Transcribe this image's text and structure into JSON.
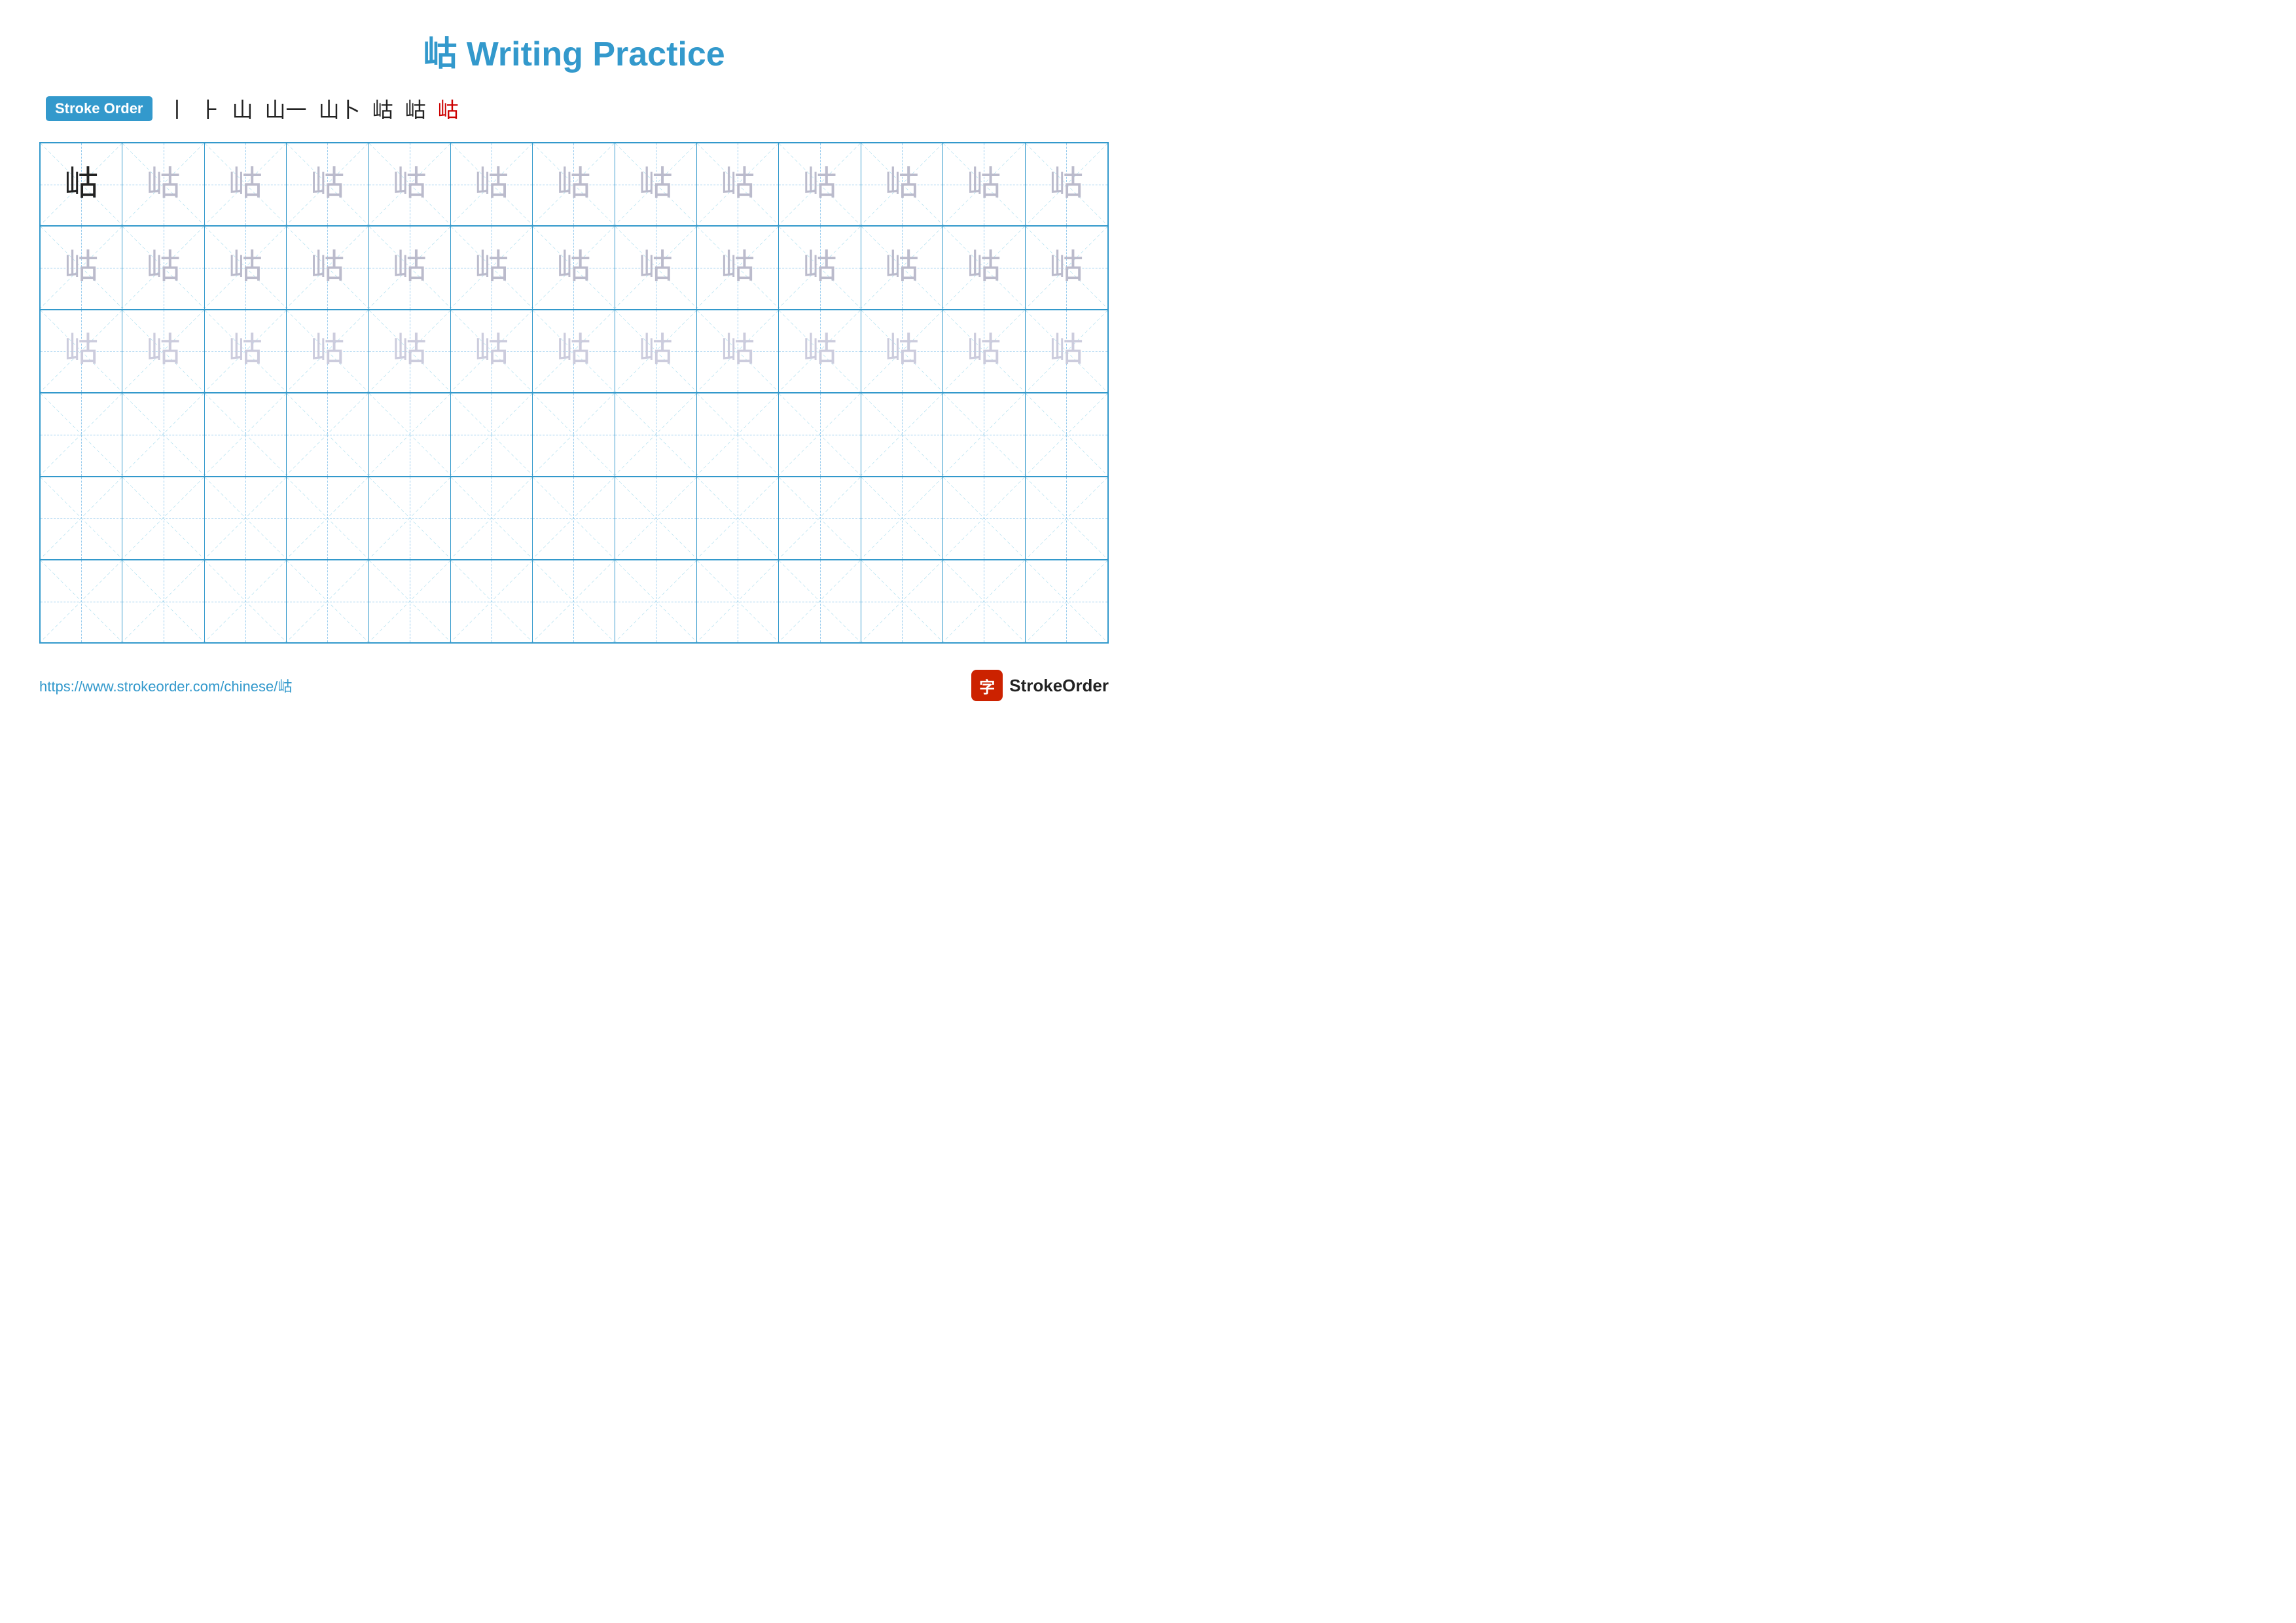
{
  "title": "岵 Writing Practice",
  "stroke_order_label": "Stroke Order",
  "stroke_sequence": [
    "丨",
    "⺊",
    "山",
    "山一",
    "山卜",
    "岵",
    "岵",
    "岵"
  ],
  "character": "岵",
  "url": "https://www.strokeorder.com/chinese/岵",
  "logo_text": "StrokeOrder",
  "logo_char": "字",
  "grid": {
    "rows": 6,
    "cols": 13,
    "row_data": [
      [
        "dark",
        "medium",
        "medium",
        "medium",
        "medium",
        "medium",
        "medium",
        "medium",
        "medium",
        "medium",
        "medium",
        "medium",
        "medium"
      ],
      [
        "medium",
        "medium",
        "medium",
        "medium",
        "medium",
        "medium",
        "medium",
        "medium",
        "medium",
        "medium",
        "medium",
        "medium",
        "medium"
      ],
      [
        "light",
        "light",
        "light",
        "light",
        "light",
        "light",
        "light",
        "light",
        "light",
        "light",
        "light",
        "light",
        "light"
      ],
      [
        "empty",
        "empty",
        "empty",
        "empty",
        "empty",
        "empty",
        "empty",
        "empty",
        "empty",
        "empty",
        "empty",
        "empty",
        "empty"
      ],
      [
        "empty",
        "empty",
        "empty",
        "empty",
        "empty",
        "empty",
        "empty",
        "empty",
        "empty",
        "empty",
        "empty",
        "empty",
        "empty"
      ],
      [
        "empty",
        "empty",
        "empty",
        "empty",
        "empty",
        "empty",
        "empty",
        "empty",
        "empty",
        "empty",
        "empty",
        "empty",
        "empty"
      ]
    ]
  }
}
